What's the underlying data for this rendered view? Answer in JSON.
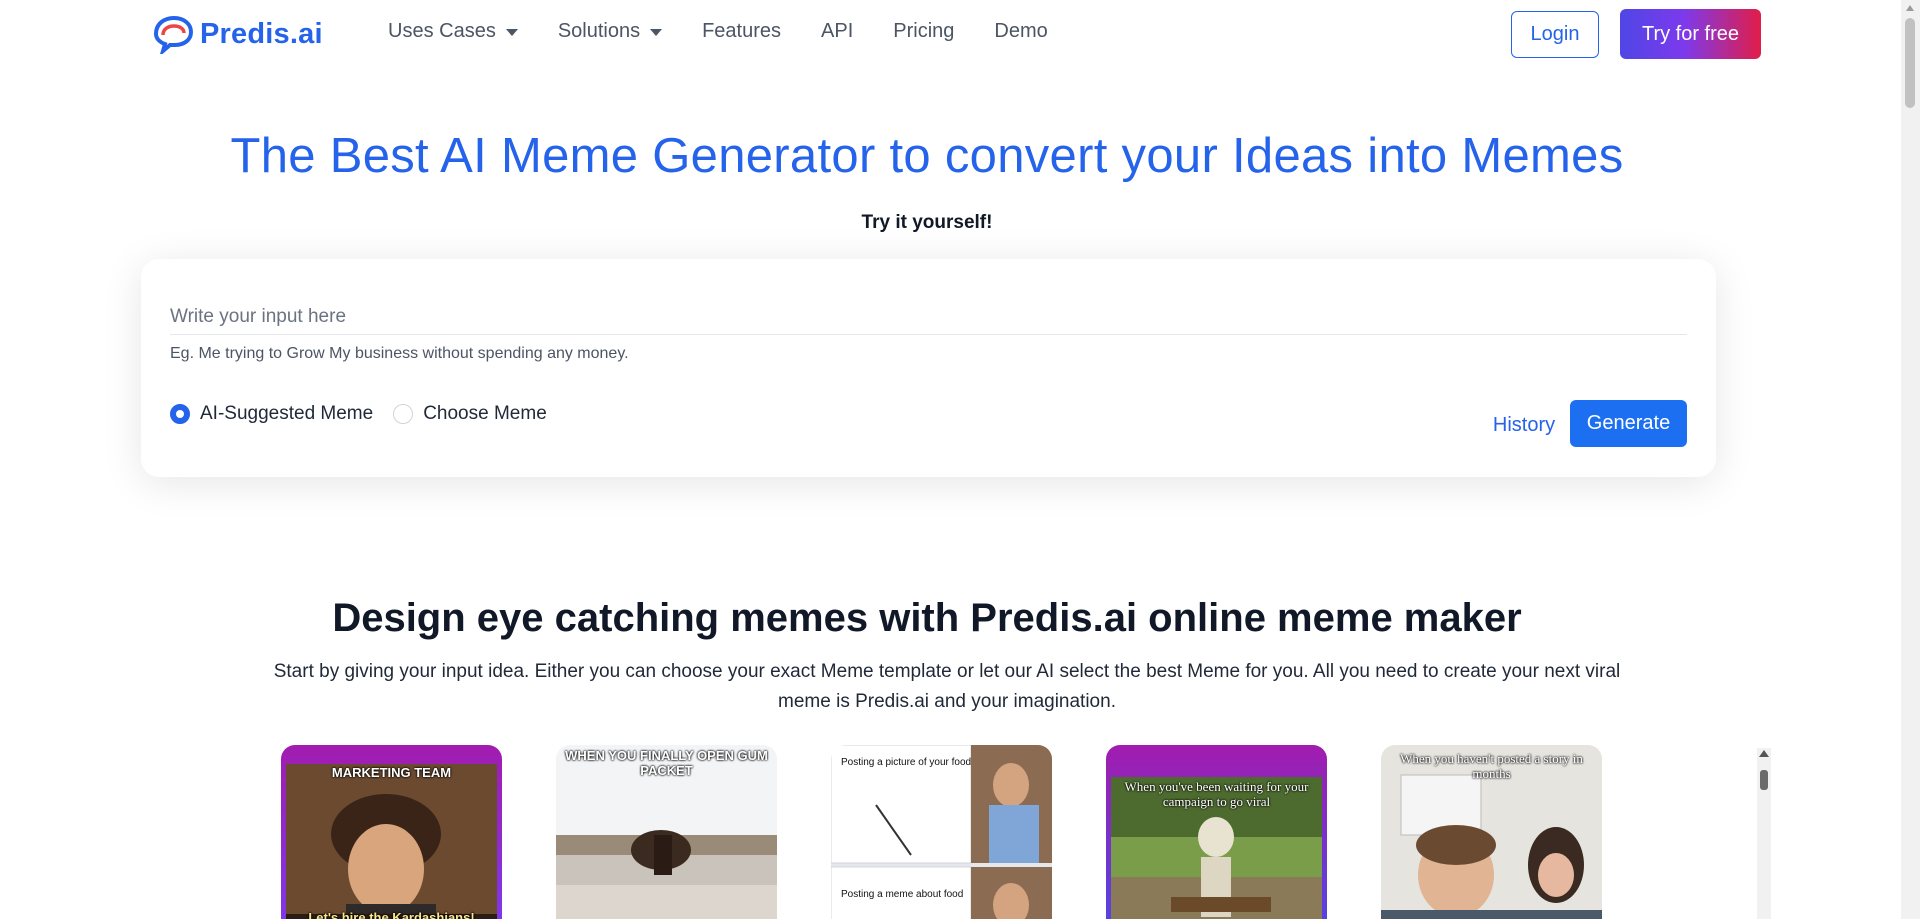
{
  "nav": {
    "logo_text": "Predis.ai",
    "items": [
      {
        "label": "Uses Cases",
        "dropdown": true
      },
      {
        "label": "Solutions",
        "dropdown": true
      },
      {
        "label": "Features",
        "dropdown": false
      },
      {
        "label": "API",
        "dropdown": false
      },
      {
        "label": "Pricing",
        "dropdown": false
      },
      {
        "label": "Demo",
        "dropdown": false
      }
    ],
    "login_label": "Login",
    "try_label": "Try for free"
  },
  "hero": {
    "title": "The Best AI Meme Generator to convert your Ideas into Memes",
    "subtitle": "Try it yourself!"
  },
  "generator": {
    "input_placeholder": "Write your input here",
    "input_value": "",
    "hint": "Eg. Me trying to Grow My business without spending any money.",
    "options": [
      {
        "label": "AI-Suggested Meme",
        "selected": true
      },
      {
        "label": "Choose Meme",
        "selected": false
      }
    ],
    "history_label": "History",
    "generate_label": "Generate"
  },
  "section": {
    "title": "Design eye catching memes with Predis.ai online meme maker",
    "description": "Start by giving your input idea. Either you can choose your exact Meme template or let our AI select the best Meme for you. All you need to create your next viral meme is Predis.ai and your imagination."
  },
  "memes": [
    {
      "top_text": "MARKETING TEAM",
      "bottom_text": "Let's hire the Kardashians!",
      "border": "gradient-purple"
    },
    {
      "top_text": "WHEN YOU FINALLY OPEN GUM PACKET",
      "bottom_text": "",
      "border": "none"
    },
    {
      "top_text": "Posting a picture of your food",
      "bottom_text": "Posting a meme about food",
      "border": "none"
    },
    {
      "top_text": "When you've been waiting for your campaign to go viral",
      "bottom_text": "",
      "border": "gradient-purple"
    },
    {
      "top_text": "When you haven't posted a story in months",
      "bottom_text": "",
      "border": "none"
    }
  ],
  "colors": {
    "brand_blue": "#2563eb",
    "generate_blue": "#1d6ff2",
    "try_gradient_start": "#4f46e5",
    "try_gradient_end": "#e11d48"
  }
}
